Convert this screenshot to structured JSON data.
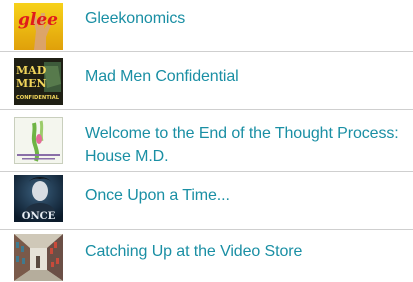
{
  "articles": [
    {
      "title": "Gleekonomics",
      "thumbnail_icon": "glee-logo-thumbnail",
      "thumbnail_text": "glee"
    },
    {
      "title": "Mad Men Confidential",
      "thumbnail_icon": "mad-men-book-cover-thumbnail",
      "thumbnail_text": "MAD MEN CONFIDENTIAL"
    },
    {
      "title": "Welcome to the End of the Thought Process: House M.D.",
      "thumbnail_icon": "house-md-thumbnail"
    },
    {
      "title": "Once Upon a Time...",
      "thumbnail_icon": "once-upon-a-time-thumbnail",
      "thumbnail_text": "ONCE"
    },
    {
      "title": "Catching Up at the Video Store",
      "thumbnail_icon": "video-store-aisle-thumbnail"
    }
  ],
  "colors": {
    "link": "#1a8fa4",
    "divider": "#cfcfcf"
  }
}
